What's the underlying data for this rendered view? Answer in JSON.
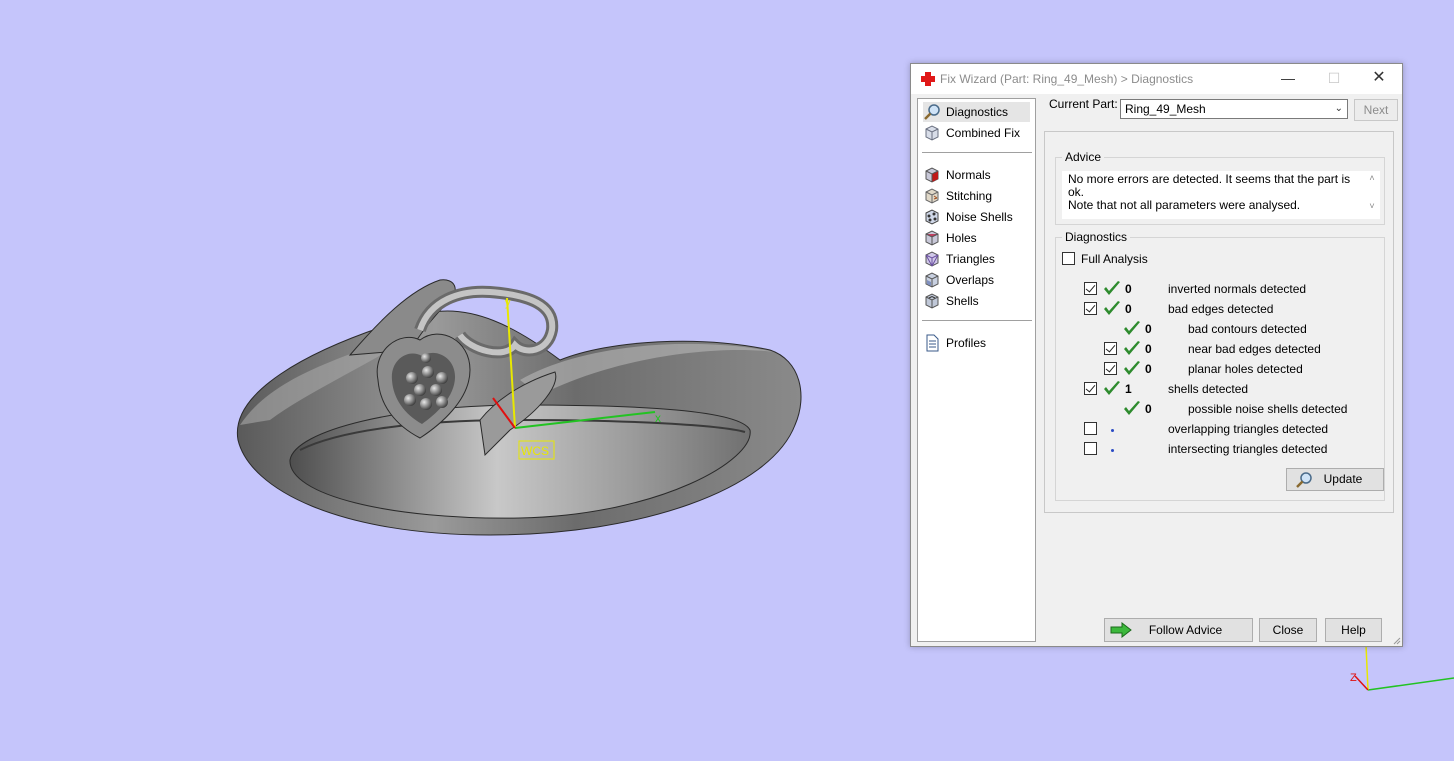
{
  "viewport": {
    "background": "#c5c5fb",
    "wcs_label": "WCS",
    "axis_x_label": "x",
    "axis_y_label": "y",
    "corner_axis_label": "Z"
  },
  "dialog": {
    "title": "Fix Wizard (Part: Ring_49_Mesh) > Diagnostics",
    "title_icon": "red-cross-icon",
    "window_buttons": {
      "minimize": "—",
      "maximize": "☐",
      "close": "✕"
    },
    "sidebar": {
      "top_items": [
        {
          "label": "Diagnostics",
          "icon": "magnifier-icon",
          "selected": true
        },
        {
          "label": "Combined Fix",
          "icon": "cube-stack-icon",
          "selected": false
        }
      ],
      "tool_items": [
        {
          "label": "Normals",
          "icon": "normals-cube-icon"
        },
        {
          "label": "Stitching",
          "icon": "stitching-cube-icon"
        },
        {
          "label": "Noise Shells",
          "icon": "noise-shells-icon"
        },
        {
          "label": "Holes",
          "icon": "holes-cube-icon"
        },
        {
          "label": "Triangles",
          "icon": "triangles-cube-icon"
        },
        {
          "label": "Overlaps",
          "icon": "overlaps-cube-icon"
        },
        {
          "label": "Shells",
          "icon": "shells-cube-icon"
        }
      ],
      "bottom_items": [
        {
          "label": "Profiles",
          "icon": "document-icon"
        }
      ]
    },
    "current_part": {
      "label": "Current Part:",
      "value": "Ring_49_Mesh"
    },
    "next_label": "Next",
    "advice": {
      "title": "Advice",
      "line1": "No more errors are detected. It seems that the part is ok.",
      "line2": "Note that not all parameters were analysed."
    },
    "diagnostics": {
      "title": "Diagnostics",
      "full_analysis_label": "Full Analysis",
      "full_analysis_checked": false,
      "rows": [
        {
          "checkbox": true,
          "checked": true,
          "status": "ok",
          "count": "0",
          "label": "inverted normals detected",
          "indent": 0
        },
        {
          "checkbox": true,
          "checked": true,
          "status": "ok",
          "count": "0",
          "label": "bad edges detected",
          "indent": 0
        },
        {
          "checkbox": false,
          "checked": false,
          "status": "ok",
          "count": "0",
          "label": "bad contours detected",
          "indent": 1
        },
        {
          "checkbox": true,
          "checked": true,
          "status": "ok",
          "count": "0",
          "label": "near bad edges detected",
          "indent": 1
        },
        {
          "checkbox": true,
          "checked": true,
          "status": "ok",
          "count": "0",
          "label": "planar holes detected",
          "indent": 1
        },
        {
          "checkbox": true,
          "checked": true,
          "status": "ok",
          "count": "1",
          "label": "shells detected",
          "indent": 0
        },
        {
          "checkbox": false,
          "checked": false,
          "status": "ok",
          "count": "0",
          "label": "possible noise shells detected",
          "indent": 1
        },
        {
          "checkbox": true,
          "checked": false,
          "status": "pending",
          "count": "",
          "label": "overlapping triangles detected",
          "indent": 0
        },
        {
          "checkbox": true,
          "checked": false,
          "status": "pending",
          "count": "",
          "label": "intersecting triangles detected",
          "indent": 0
        }
      ],
      "update_label": "Update"
    },
    "footer": {
      "follow_advice_label": "Follow Advice",
      "close_label": "Close",
      "help_label": "Help"
    },
    "colors": {
      "check_green": "#2e8b2e",
      "arrow_green": "#3cb83c",
      "dot_blue": "#2a4bc4"
    }
  }
}
